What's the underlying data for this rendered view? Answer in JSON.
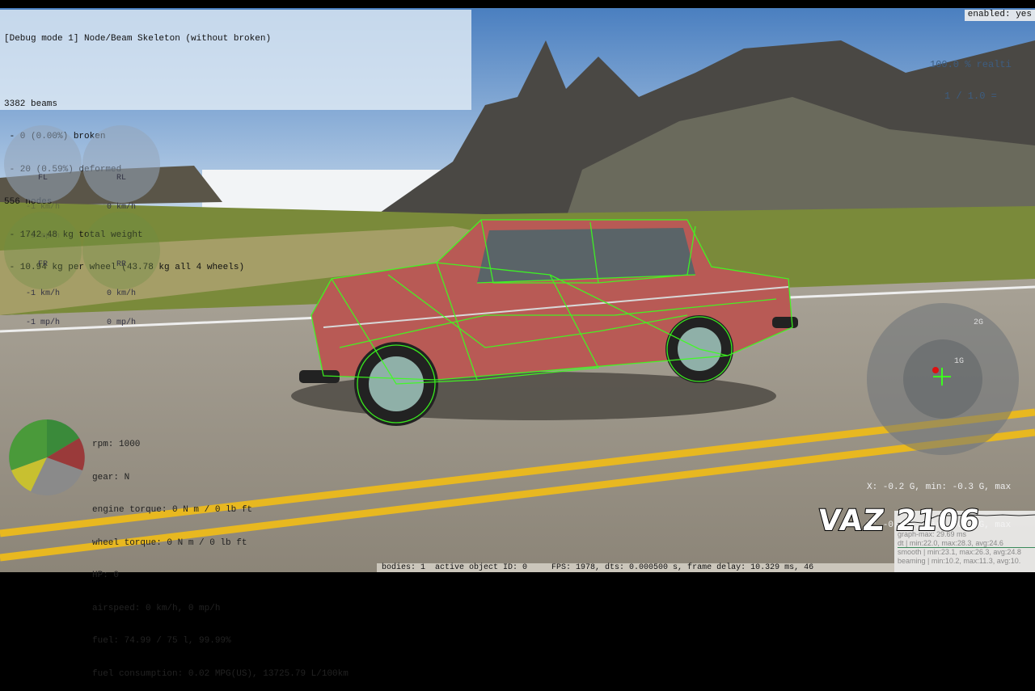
{
  "debug": {
    "title": "[Debug mode 1] Node/Beam Skeleton (without broken)",
    "lines": [
      "3382 beams",
      " - 0 (0.00%) broken",
      " - 20 (0.59%) deformed",
      "556 nodes",
      " - 1742.48 kg total weight",
      " - 10.94 kg per wheel (43.78 kg all 4 wheels)"
    ]
  },
  "top_right": {
    "enabled": "enabled: yes",
    "realtime": "100.0 % realti",
    "ratio": "1 / 1.0 ="
  },
  "wheels": [
    {
      "label": "FL",
      "kmh": "-1 km/h",
      "mph": "-1 mp/h"
    },
    {
      "label": "RL",
      "kmh": "0 km/h",
      "mph": ""
    },
    {
      "label": "FR",
      "kmh": "-1 km/h",
      "mph": "-1 mp/h"
    },
    {
      "label": "RR",
      "kmh": "0 km/h",
      "mph": "0 mp/h"
    }
  ],
  "engine": {
    "lines": [
      "rpm: 1000",
      "gear: N",
      "engine torque: 0 N m / 0 lb ft",
      "wheel torque: 0 N m / 0 lb ft",
      "HP: 0",
      "airspeed: 0 km/h, 0 mp/h",
      "fuel: 74.99 / 75 l, 99.99%",
      "fuel consumption: 0.02 MPG(US), 13725.79 L/100km"
    ]
  },
  "gmeter": {
    "ring2": "2G",
    "ring1": "1G",
    "x": "X: -0.2 G, min: -0.3 G, max",
    "y": "Y: -0.3 G, min: -0.3 G, max"
  },
  "vehicle_name": "VAZ 2106",
  "graph": {
    "lines": [
      "graph-max: 29.69 ms",
      "dt   | min:22.0, max:28.3, avg:24.6",
      "smooth | min:23.1, max:26.3, avg:24.8",
      "beaming | min:10.2, max:11.3, avg:10."
    ]
  },
  "statusbar": "bodies: 1  active object ID: 0     FPS: 1978, dts: 0.000500 s, frame delay: 10.329 ms, 46",
  "colors": {
    "skeleton": "#3cff1e",
    "car_body": "#b85a55",
    "road_line": "#e8b820"
  }
}
